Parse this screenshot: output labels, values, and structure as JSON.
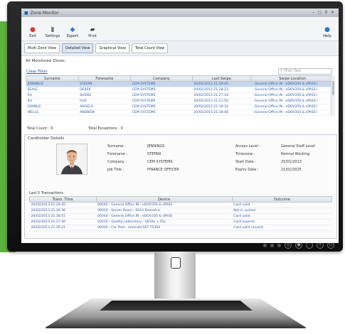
{
  "window": {
    "title": "Zone Monitor",
    "controls": [
      "–",
      "◻",
      "⚲",
      "✕"
    ]
  },
  "toolbar": {
    "buttons": [
      {
        "label": "Exit",
        "icon": "exit-icon",
        "glyph": "●",
        "color": "#d43a2f"
      },
      {
        "label": "Settings",
        "icon": "settings-icon",
        "glyph": "▮",
        "color": "#6b7077"
      },
      {
        "label": "Export",
        "icon": "export-icon",
        "glyph": "◆",
        "color": "#2f79c6"
      },
      {
        "label": "Print",
        "icon": "print-icon",
        "glyph": "▰",
        "color": "#444"
      }
    ],
    "help": {
      "label": "Help",
      "icon": "help-icon",
      "glyph": "●",
      "color": "#2f79c6"
    }
  },
  "tabs": [
    "Multi Zone View",
    "Detailed View",
    "Graphical View",
    "Total Count View"
  ],
  "active_tab": 1,
  "zones": {
    "section_label": "All Monitored Zones",
    "clear_filter": "Clear Filter",
    "filter_placeholder": "Filter Text",
    "columns": [
      "Surname",
      "Forename",
      "Company",
      "Last Swipe",
      "Swipe Location"
    ],
    "rows": [
      [
        "JENNINGS",
        "STEFAN",
        "CEM SYSTEMS",
        "20/02/2013 21:29:45",
        "- General Office IN - eDOV350 & sPASS l"
      ],
      [
        "SEALE",
        "DEREK",
        "CEM SYSTEMS",
        "20/02/2013 21:28:23",
        "- General Office IN - eDOV350 & sPASS l"
      ],
      [
        "RU",
        "SHENG",
        "CEM SYSTEMS",
        "20/02/2013 21:27:18",
        "- General Office IN - eDOV350 & sPASS l"
      ],
      [
        "RU",
        "HUA",
        "CEM SYSTEMS",
        "20/02/2013 21:21:50",
        "- General Office IN - eDOV350 & sPASS l"
      ],
      [
        "GAMBLE",
        "ANGELA",
        "CEM SYSTEMS",
        "20/02/2013 21:19:34",
        "- General Office IN - eDOV350 & sPASS l"
      ],
      [
        "WELLS",
        "ANDREW",
        "CEM SYSTEMS",
        "20/02/2013 21:18:48",
        "- General Office IN - eDOV350 & sPASS l"
      ]
    ],
    "selected_row": 0,
    "total_count": "Total Count : 9",
    "total_exceptions": "Total Exceptions : 0"
  },
  "details": {
    "title": "Cardholder Details",
    "fields_left": [
      {
        "label": "Surname :",
        "value": "JENNINGS"
      },
      {
        "label": "Forename :",
        "value": "STEFAN"
      },
      {
        "label": "Company :",
        "value": "CEM SYSTEMS"
      },
      {
        "label": "Job Title :",
        "value": "FINANCE OFFICER"
      }
    ],
    "fields_right": [
      {
        "label": "Access Level :",
        "value": "General Staff Level"
      },
      {
        "label": "Timezone :",
        "value": "Normal Working"
      },
      {
        "label": "Start Date :",
        "value": "25/01/2013"
      },
      {
        "label": "Expiry Date :",
        "value": "21/01/2025"
      }
    ],
    "last5_label": "Last 5 Transactions",
    "trans_columns": [
      "Trans. Time",
      "Device",
      "Outcome"
    ],
    "transactions": [
      [
        "20/02/2013 21:29:45",
        "00040 - General Office IN - eDOV350 & sPASS",
        "Card valid"
      ],
      [
        "20/02/2013 21:29:36",
        "00020 - Server Room - S610 Biometric",
        "Not in system"
      ],
      [
        "20/02/2013 21:28:51",
        "00040 - General Office IN - eDOV350 & sPASS",
        "Card valid"
      ],
      [
        "20/02/2013 21:27:40",
        "00010 - Quality Laboratory - S610e + S5c",
        "Card expired"
      ],
      [
        "20/02/2013 21:26:21",
        "00030 - Car Park - emerald S6T T5300",
        "Card valid unused"
      ]
    ]
  },
  "colors": {
    "accent_green": "#5db33a",
    "link_blue": "#2b5ca3",
    "selected_row": "#c7d7ee"
  }
}
